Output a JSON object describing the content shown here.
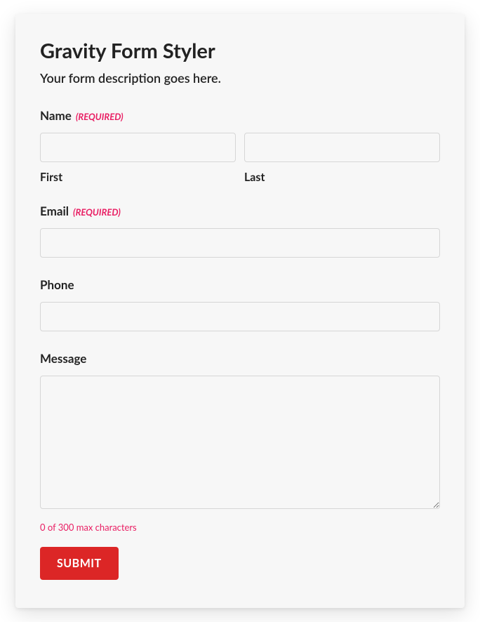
{
  "form": {
    "title": "Gravity Form Styler",
    "description": "Your form description goes here.",
    "required_text": "(REQUIRED)",
    "fields": {
      "name": {
        "label": "Name",
        "required": true,
        "first_sublabel": "First",
        "last_sublabel": "Last",
        "first_value": "",
        "last_value": ""
      },
      "email": {
        "label": "Email",
        "required": true,
        "value": ""
      },
      "phone": {
        "label": "Phone",
        "required": false,
        "value": ""
      },
      "message": {
        "label": "Message",
        "required": false,
        "value": "",
        "char_count_text": "0 of 300 max characters",
        "max_chars": 300,
        "current_chars": 0
      }
    },
    "submit_label": "SUBMIT"
  }
}
